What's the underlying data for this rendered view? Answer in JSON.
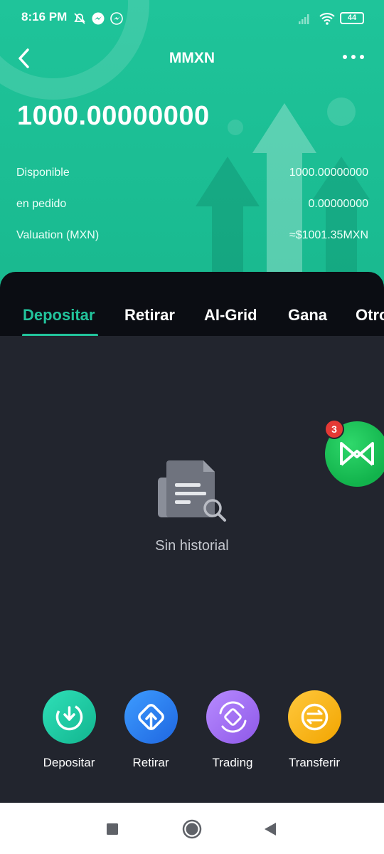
{
  "status_bar": {
    "time": "8:16 PM",
    "battery": "44"
  },
  "header": {
    "title": "MMXN",
    "balance": "1000.00000000"
  },
  "rows": [
    {
      "label": "Disponible",
      "value": "1000.00000000"
    },
    {
      "label": "en pedido",
      "value": "0.00000000"
    },
    {
      "label": "Valuation (MXN)",
      "value": "≈$1001.35MXN"
    }
  ],
  "tabs": [
    {
      "label": "Depositar",
      "active": true
    },
    {
      "label": "Retirar"
    },
    {
      "label": "AI-Grid"
    },
    {
      "label": "Gana"
    },
    {
      "label": "Otros"
    }
  ],
  "empty": {
    "text": "Sin historial",
    "icon": "document-search-icon"
  },
  "floating": {
    "count": "3",
    "icon": "mexc-logo-icon"
  },
  "actions": [
    {
      "label": "Depositar",
      "icon": "deposit-icon",
      "color": "#1fc7a4"
    },
    {
      "label": "Retirar",
      "icon": "withdraw-icon",
      "color": "#2d7ff0"
    },
    {
      "label": "Trading",
      "icon": "trading-icon",
      "color": "#a36ff0"
    },
    {
      "label": "Transferir",
      "icon": "transfer-icon",
      "color": "#f7b500"
    }
  ],
  "colors": {
    "accent": "#22c49c",
    "header_bg": "#1fc49a",
    "panel_bg": "#22252e"
  }
}
